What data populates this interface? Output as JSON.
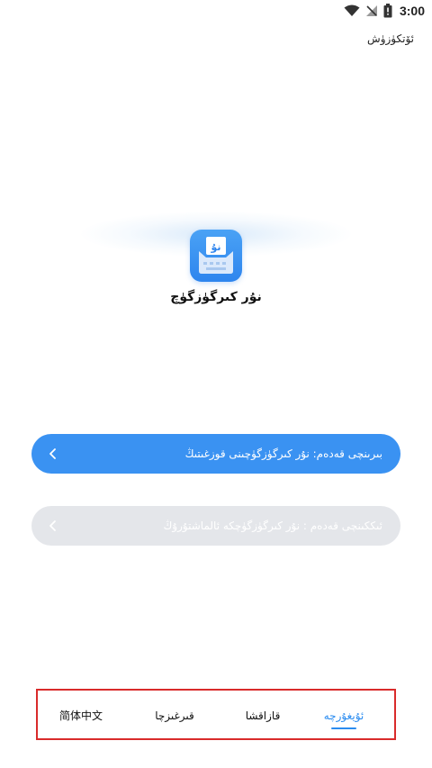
{
  "status_bar": {
    "time": "3:00",
    "icons": [
      "wifi-icon",
      "no-signal-icon",
      "battery-icon"
    ]
  },
  "header": {
    "skip_label": "ئۆتكۈزۈش"
  },
  "app": {
    "icon_glyph": "نۇ",
    "name": "نۇر كىرگۈزگۈچ"
  },
  "steps": [
    {
      "label": "بىرىنچى قەدەم: نۇر كىرگۈزگۈچىنى قوزغىتىڭ",
      "state": "enabled"
    },
    {
      "label": "ئىككىنچى قەدەم : نۇر كىرگۈزگۈچكە ئالماشتۇرۇڭ",
      "state": "disabled"
    }
  ],
  "languages": {
    "items": [
      {
        "label": "简体中文",
        "active": false
      },
      {
        "label": "قىرغىزچا",
        "active": false
      },
      {
        "label": "قازاقشا",
        "active": false
      },
      {
        "label": "ئۇيغۇرچە",
        "active": true
      }
    ],
    "active_color": "#2b8cf0"
  },
  "colors": {
    "primary": "#3a92f2",
    "disabled": "#e4e6ea",
    "highlight_border": "#d92b2b"
  }
}
